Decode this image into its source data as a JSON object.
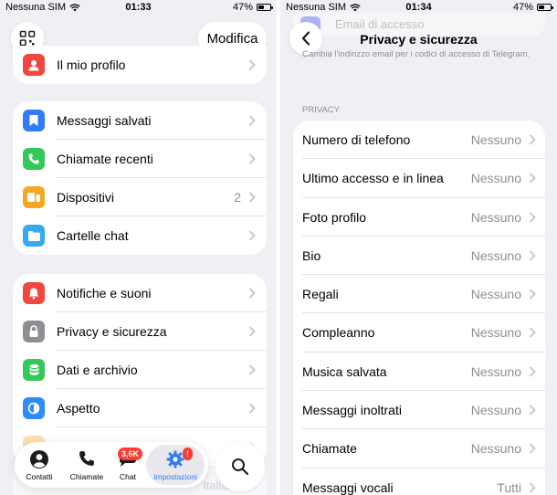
{
  "left": {
    "status": {
      "carrier": "Nessuna SIM",
      "time": "01:33",
      "battery": "47%"
    },
    "edit_label": "Modifica",
    "profile": {
      "label": "Il mio profilo"
    },
    "group1": [
      {
        "label": "Messaggi salvati",
        "value": "",
        "icon": "bookmark-icon",
        "color": "#2f7cf6"
      },
      {
        "label": "Chiamate recenti",
        "value": "",
        "icon": "phone-icon",
        "color": "#34c759"
      },
      {
        "label": "Dispositivi",
        "value": "2",
        "icon": "devices-icon",
        "color": "#f5a623"
      },
      {
        "label": "Cartelle chat",
        "value": "",
        "icon": "folder-icon",
        "color": "#37a9ef"
      }
    ],
    "group2": [
      {
        "label": "Notifiche e suoni",
        "value": "",
        "icon": "bell-icon",
        "color": "#f0473f"
      },
      {
        "label": "Privacy e sicurezza",
        "value": "",
        "icon": "lock-icon",
        "color": "#8e8e93"
      },
      {
        "label": "Dati e archivio",
        "value": "",
        "icon": "storage-icon",
        "color": "#34c759"
      },
      {
        "label": "Aspetto",
        "value": "",
        "icon": "appearance-icon",
        "color": "#2f8cf6"
      }
    ],
    "faded_value": "Italiano",
    "tabs": [
      {
        "label": "Contatti",
        "icon": "contacts-icon"
      },
      {
        "label": "Chiamate",
        "icon": "calls-icon"
      },
      {
        "label": "Chat",
        "icon": "chat-icon",
        "badge": "3,6K"
      },
      {
        "label": "Impostazioni",
        "icon": "settings-icon",
        "badge": "!"
      }
    ],
    "accent": "#2f7cf6"
  },
  "right": {
    "status": {
      "carrier": "Nessuna SIM",
      "time": "01:34",
      "battery": "47%"
    },
    "title": "Privacy e sicurezza",
    "faded_row": "Email di accesso",
    "footer_note": "Cambia l'indirizzo email per i codici di accesso di Telegram.",
    "section_header": "PRIVACY",
    "rows": [
      {
        "label": "Numero di telefono",
        "value": "Nessuno"
      },
      {
        "label": "Ultimo accesso e in linea",
        "value": "Nessuno"
      },
      {
        "label": "Foto profilo",
        "value": "Nessuno"
      },
      {
        "label": "Bio",
        "value": "Nessuno"
      },
      {
        "label": "Regali",
        "value": "Nessuno"
      },
      {
        "label": "Compleanno",
        "value": "Nessuno"
      },
      {
        "label": "Musica salvata",
        "value": "Nessuno"
      },
      {
        "label": "Messaggi inoltrati",
        "value": "Nessuno"
      },
      {
        "label": "Chiamate",
        "value": "Nessuno"
      },
      {
        "label": "Messaggi vocali",
        "value": "Tutti"
      }
    ]
  }
}
